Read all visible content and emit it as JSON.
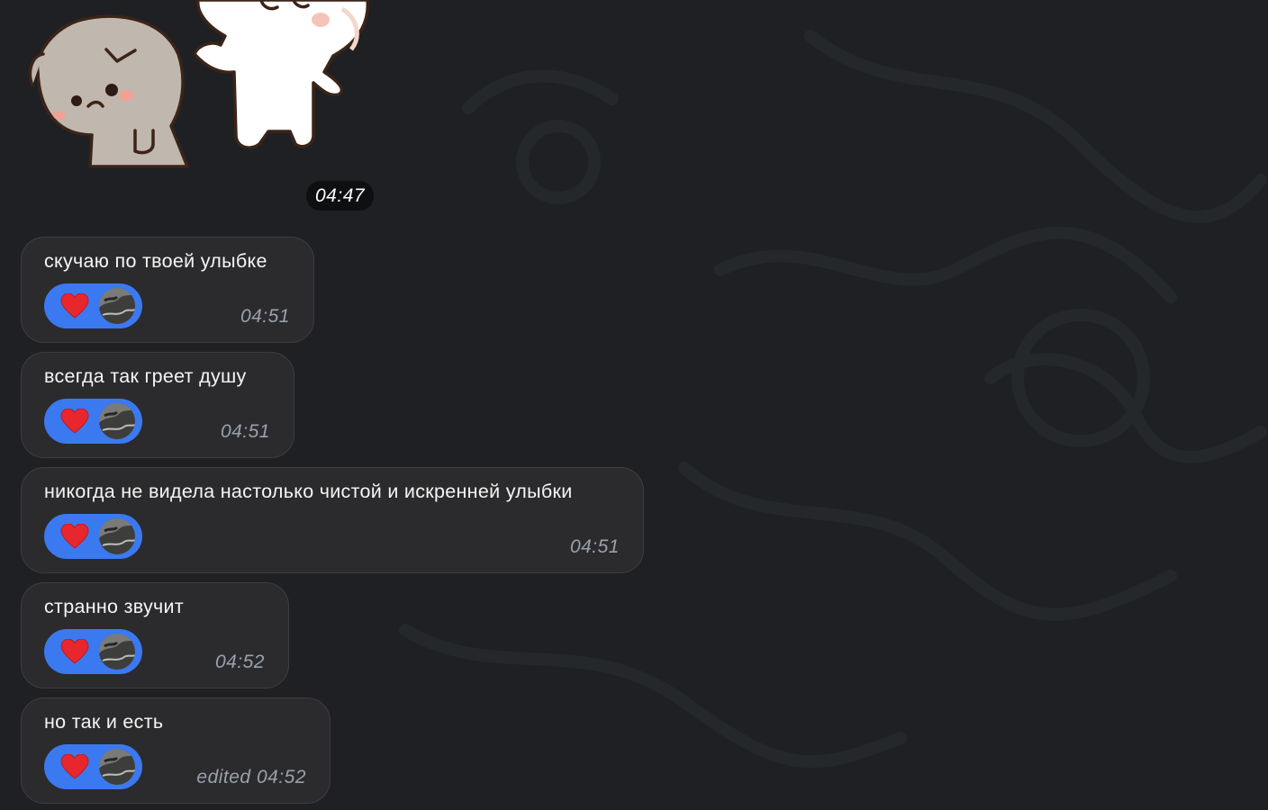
{
  "sticker": {
    "icon": "cat-bunny-sticker-icon",
    "time": "04:47"
  },
  "messages": [
    {
      "text": "скучаю по твоей улыбке",
      "reaction_emoji": "heart-icon",
      "time": "04:51"
    },
    {
      "text": "всегда так греет душу",
      "reaction_emoji": "heart-icon",
      "time": "04:51"
    },
    {
      "text": "никогда не видела настолько чистой и искренней улыбки",
      "reaction_emoji": "heart-icon",
      "time": "04:51"
    },
    {
      "text": "странно звучит",
      "reaction_emoji": "heart-icon",
      "time": "04:52"
    },
    {
      "text": "но так и есть",
      "reaction_emoji": "heart-icon",
      "time": "edited 04:52"
    }
  ],
  "colors": {
    "background": "#1e2023",
    "bubble": "#2b2b2d",
    "reaction_pill": "#3b79f1",
    "heart": "#e8262d",
    "time_text": "#9aa1ad"
  }
}
